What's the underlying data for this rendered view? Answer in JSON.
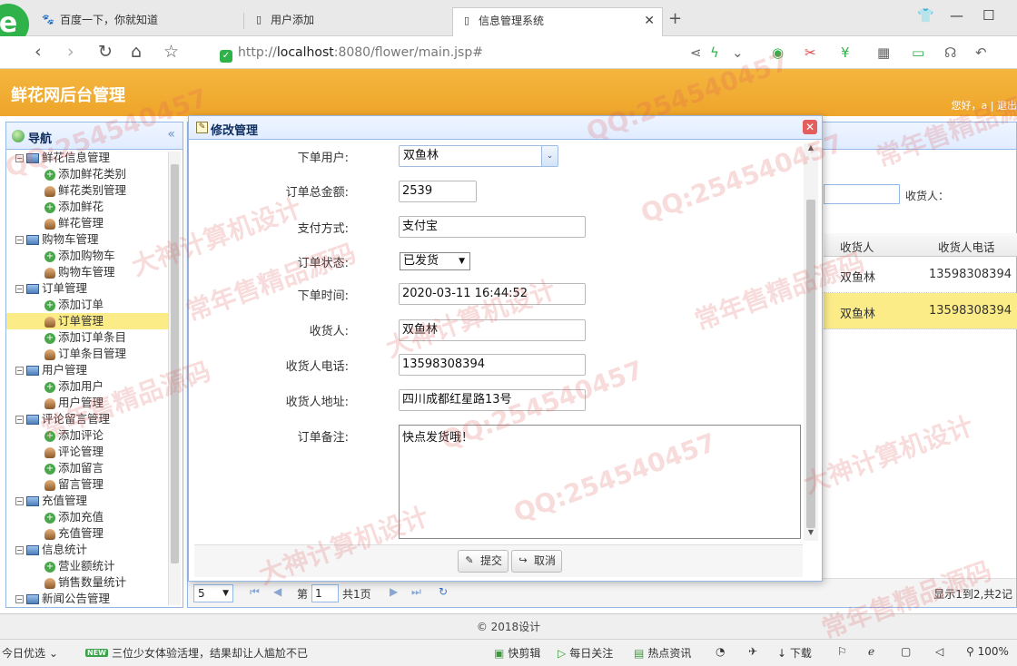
{
  "browser": {
    "tabs": [
      {
        "label": "百度一下，你就知道",
        "icon": "paw-icon"
      },
      {
        "label": "用户添加",
        "icon": "document-icon"
      },
      {
        "label": "信息管理系统",
        "icon": "document-icon"
      }
    ],
    "url_prefix": "http://",
    "url_host": "localhost",
    "url_rest": ":8080/flower/main.jsp#"
  },
  "app": {
    "title": "鲜花网后台管理",
    "greeting": "您好，a | 退出"
  },
  "nav": {
    "title": "导航",
    "groups": [
      {
        "label": "鲜花信息管理",
        "items": [
          {
            "label": "添加鲜花类别",
            "icon": "plus"
          },
          {
            "label": "鲜花类别管理",
            "icon": "user"
          },
          {
            "label": "添加鲜花",
            "icon": "plus"
          },
          {
            "label": "鲜花管理",
            "icon": "user"
          }
        ]
      },
      {
        "label": "购物车管理",
        "items": [
          {
            "label": "添加购物车",
            "icon": "plus"
          },
          {
            "label": "购物车管理",
            "icon": "user"
          }
        ]
      },
      {
        "label": "订单管理",
        "items": [
          {
            "label": "添加订单",
            "icon": "plus"
          },
          {
            "label": "订单管理",
            "icon": "user",
            "selected": true
          },
          {
            "label": "添加订单条目",
            "icon": "plus"
          },
          {
            "label": "订单条目管理",
            "icon": "user"
          }
        ]
      },
      {
        "label": "用户管理",
        "items": [
          {
            "label": "添加用户",
            "icon": "plus"
          },
          {
            "label": "用户管理",
            "icon": "user"
          }
        ]
      },
      {
        "label": "评论留言管理",
        "items": [
          {
            "label": "添加评论",
            "icon": "plus"
          },
          {
            "label": "评论管理",
            "icon": "user"
          },
          {
            "label": "添加留言",
            "icon": "plus"
          },
          {
            "label": "留言管理",
            "icon": "user"
          }
        ]
      },
      {
        "label": "充值管理",
        "items": [
          {
            "label": "添加充值",
            "icon": "plus"
          },
          {
            "label": "充值管理",
            "icon": "user"
          }
        ]
      },
      {
        "label": "信息统计",
        "items": [
          {
            "label": "营业额统计",
            "icon": "plus"
          },
          {
            "label": "销售数量统计",
            "icon": "user"
          }
        ]
      },
      {
        "label": "新闻公告管理",
        "items": []
      }
    ]
  },
  "grid": {
    "search_label": "收货人：",
    "columns": [
      "收货人",
      "收货人电话"
    ],
    "rows": [
      {
        "receiver": "双鱼林",
        "phone": "13598308394",
        "selected": false
      },
      {
        "receiver": "双鱼林",
        "phone": "13598308394",
        "selected": true
      }
    ]
  },
  "pager": {
    "page_size": "5",
    "page_prefix": "第",
    "page_value": "1",
    "page_suffix": "共1页",
    "info": "显示1到2,共2记"
  },
  "footer": "© 2018设计",
  "dialog": {
    "title": "修改管理",
    "fields": {
      "user_label": "下单用户:",
      "user_value": "双鱼林",
      "total_label": "订单总金额:",
      "total_value": "2539",
      "pay_label": "支付方式:",
      "pay_value": "支付宝",
      "status_label": "订单状态:",
      "status_value": "已发货",
      "time_label": "下单时间:",
      "time_value": "2020-03-11 16:44:52",
      "receiver_label": "收货人:",
      "receiver_value": "双鱼林",
      "phone_label": "收货人电话:",
      "phone_value": "13598308394",
      "address_label": "收货人地址:",
      "address_value": "四川成都红星路13号",
      "memo_label": "订单备注:",
      "memo_value": "快点发货哦！"
    },
    "submit_label": "提交",
    "cancel_label": "取消"
  },
  "statusbar": {
    "left": "今日优选",
    "news_badge": "NEW",
    "news": "三位少女体验活埋，结果却让人尴尬不已",
    "items": [
      "快剪辑",
      "每日关注",
      "热点资讯",
      "下载"
    ],
    "zoom": "100%"
  },
  "watermarks": [
    "QQ:254540457",
    "常年售精品源码",
    "大神计算机设计"
  ]
}
